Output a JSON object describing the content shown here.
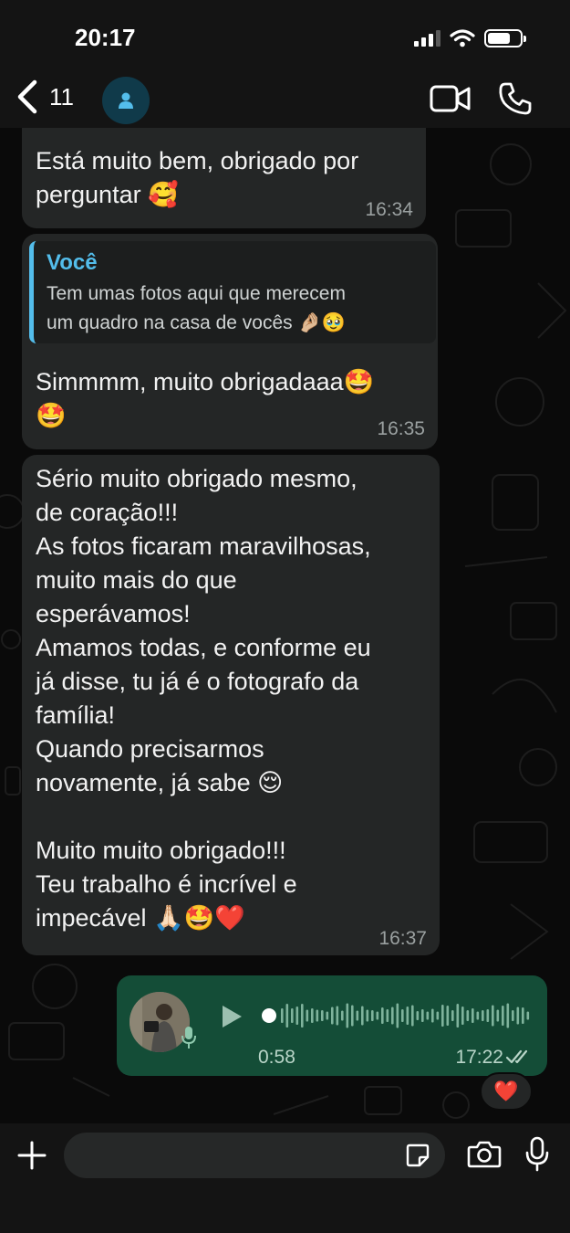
{
  "status_bar": {
    "time": "20:17"
  },
  "header": {
    "back_count": "11",
    "icons": [
      "chevron-left-icon",
      "contact-avatar-icon",
      "video-call-icon",
      "voice-call-icon"
    ]
  },
  "messages": [
    {
      "text": "Está muito bem, obrigado por\nperguntar 🥰",
      "time": "16:34"
    },
    {
      "quote": {
        "author": "Você",
        "text": "Tem umas fotos aqui que merecem\num quadro na casa de vocês 🤌🏼🥹"
      },
      "text": "Simmmm, muito obrigadaaa🤩\n🤩",
      "time": "16:35"
    },
    {
      "text": "Sério muito obrigado mesmo,\nde coração!!!\nAs fotos ficaram maravilhosas,\nmuito mais do que\nesperávamos!\nAmamos todas, e conforme eu\njá disse, tu já é o fotografo da\nfamília!\nQuando precisarmos\nnovamente, já sabe 😌\n\nMuito muito obrigado!!!\nTeu trabalho é incrível e\nimpecável 🙏🏻🤩❤️",
      "time": "16:37"
    }
  ],
  "voice_message": {
    "duration": "0:58",
    "time": "17:22",
    "status": "read",
    "reaction": "❤️"
  },
  "composer": {
    "placeholder": ""
  },
  "colors": {
    "bubble_in": "#242626",
    "bubble_out": "#144d37",
    "accent": "#53bdeb",
    "background": "#0a0a0a"
  }
}
